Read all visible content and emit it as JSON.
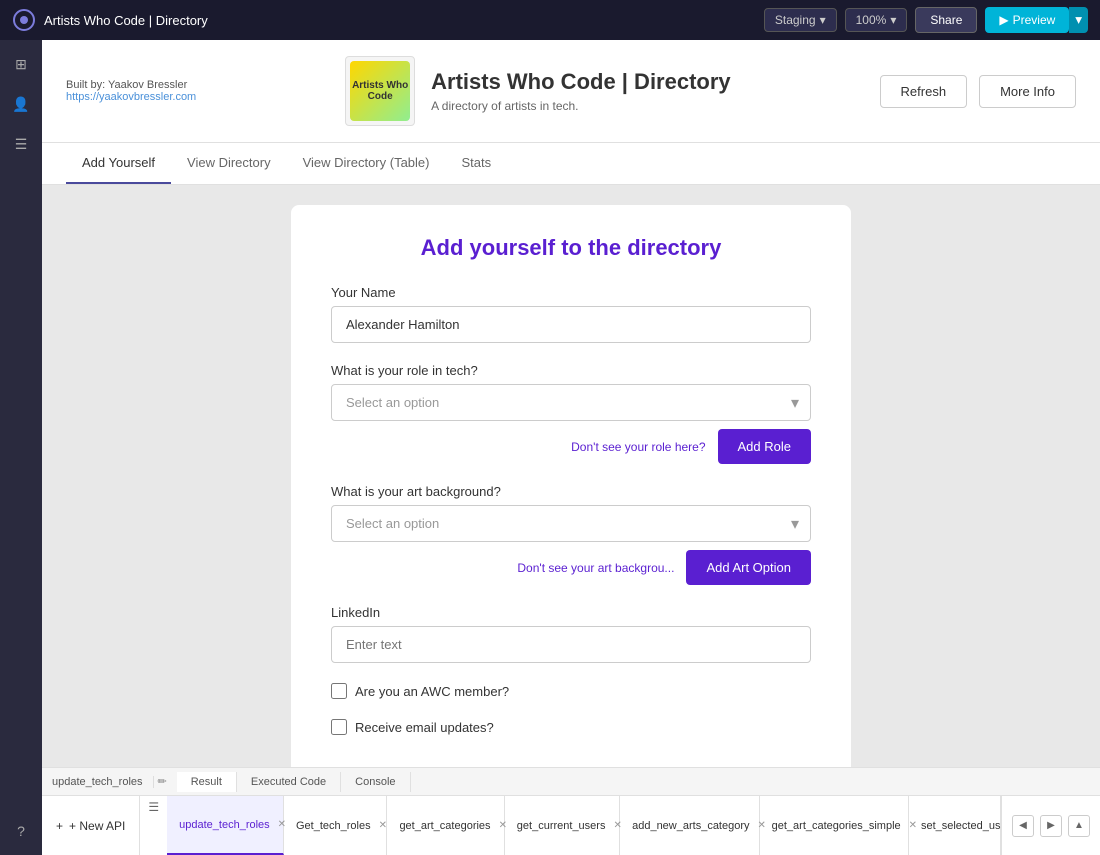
{
  "topbar": {
    "title": "Artists Who Code | Directory",
    "staging_label": "Staging",
    "zoom_label": "100%",
    "share_label": "Share",
    "preview_label": "Preview"
  },
  "app_header": {
    "built_by": "Built by: Yaakov Bressler",
    "built_by_link": "https://yaakovbressler.com",
    "title": "Artists Who Code | Directory",
    "subtitle": "A directory of artists in tech.",
    "logo_text": "Artists\nWho\nCode",
    "refresh_label": "Refresh",
    "more_info_label": "More Info"
  },
  "tabs": [
    {
      "label": "Add Yourself",
      "active": true
    },
    {
      "label": "View Directory",
      "active": false
    },
    {
      "label": "View Directory (Table)",
      "active": false
    },
    {
      "label": "Stats",
      "active": false
    }
  ],
  "form": {
    "title": "Add yourself to the directory",
    "name_label": "Your Name",
    "name_value": "Alexander Hamilton",
    "role_label": "What is your role in tech?",
    "role_placeholder": "Select an option",
    "dont_see_role": "Don't see your role here?",
    "add_role_label": "Add Role",
    "art_label": "What is your art background?",
    "art_placeholder": "Select an option",
    "dont_see_art": "Don't see your art backgrou...",
    "add_art_label": "Add Art Option",
    "linkedin_label": "LinkedIn",
    "linkedin_placeholder": "Enter text",
    "awc_member_label": "Are you an AWC member?",
    "email_updates_label": "Receive email updates?"
  },
  "bottom_tabs": [
    {
      "label": "update_tech_roles",
      "active": true,
      "closable": true
    },
    {
      "label": "Get_tech_roles",
      "active": false,
      "closable": true
    },
    {
      "label": "get_art_categories",
      "active": false,
      "closable": true
    },
    {
      "label": "get_current_users",
      "active": false,
      "closable": true
    },
    {
      "label": "add_new_arts_category",
      "active": false,
      "closable": true
    },
    {
      "label": "get_art_categories_simple",
      "active": false,
      "closable": true
    },
    {
      "label": "set_selected_us",
      "active": false,
      "closable": false
    }
  ],
  "result_tabs": [
    {
      "label": "Result",
      "active": true
    },
    {
      "label": "Executed Code",
      "active": false
    },
    {
      "label": "Console",
      "active": false
    }
  ],
  "sidebar_icons": [
    "☰",
    "👤",
    "☰"
  ],
  "new_api_label": "+ New API"
}
